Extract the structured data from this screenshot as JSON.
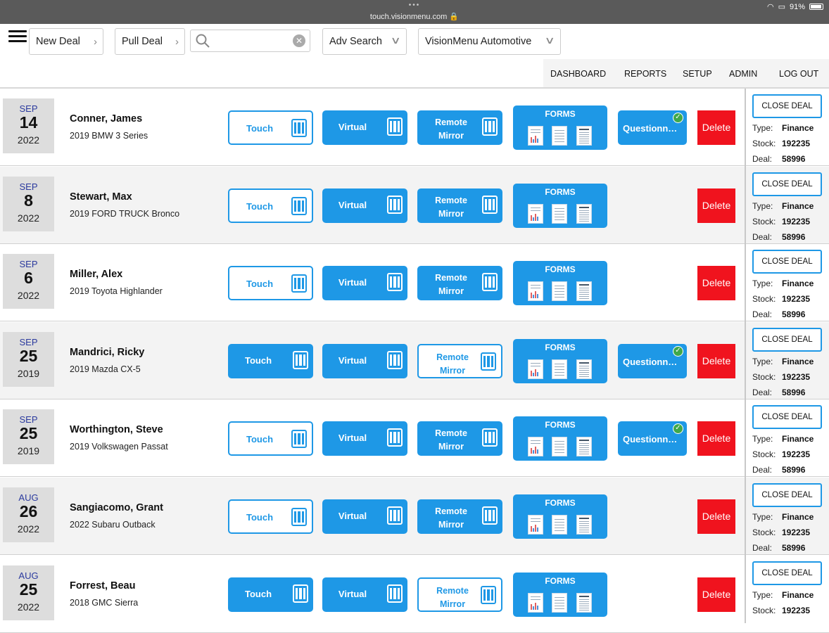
{
  "status_bar": {
    "dots": "•••",
    "url": "touch.visionmenu.com 🔒",
    "system": "91%"
  },
  "toolbar": {
    "new_deal": "New Deal",
    "pull_deal": "Pull Deal",
    "search_placeholder": "",
    "adv_search": "Adv Search",
    "dealer": "VisionMenu Automotive"
  },
  "nav": [
    "DASHBOARD",
    "REPORTS",
    "SETUP",
    "ADMIN",
    "LOG OUT"
  ],
  "labels": {
    "touch": "Touch",
    "virtual": "Virtual",
    "remote_1": "Remote",
    "remote_2": "Mirror",
    "forms": "FORMS",
    "questionnaire": "Questionnai...",
    "delete": "Delete",
    "close_deal": "CLOSE DEAL",
    "type_key": "Type:",
    "stock_key": "Stock:",
    "deal_key": "Deal:"
  },
  "colors": {
    "accent": "#1e98e6",
    "delete": "#f0131e",
    "check": "#3fa84a"
  },
  "deals": [
    {
      "month": "SEP",
      "day": "14",
      "year": "2022",
      "customer": "Conner, James",
      "vehicle": "2019 BMW 3 Series",
      "touch_outlined": true,
      "remote_outlined": false,
      "questionnaire": true,
      "type": "Finance",
      "stock": "192235",
      "deal": "58996"
    },
    {
      "month": "SEP",
      "day": "8",
      "year": "2022",
      "customer": "Stewart, Max",
      "vehicle": "2019 FORD TRUCK Bronco",
      "touch_outlined": true,
      "remote_outlined": false,
      "questionnaire": false,
      "type": "Finance",
      "stock": "192235",
      "deal": "58996"
    },
    {
      "month": "SEP",
      "day": "6",
      "year": "2022",
      "customer": "Miller, Alex",
      "vehicle": "2019 Toyota Highlander",
      "touch_outlined": true,
      "remote_outlined": false,
      "questionnaire": false,
      "type": "Finance",
      "stock": "192235",
      "deal": "58996"
    },
    {
      "month": "SEP",
      "day": "25",
      "year": "2019",
      "customer": "Mandrici, Ricky",
      "vehicle": "2019 Mazda CX-5",
      "touch_outlined": false,
      "remote_outlined": true,
      "questionnaire": true,
      "type": "Finance",
      "stock": "192235",
      "deal": "58996"
    },
    {
      "month": "SEP",
      "day": "25",
      "year": "2019",
      "customer": "Worthington, Steve",
      "vehicle": "2019 Volkswagen Passat",
      "touch_outlined": true,
      "remote_outlined": false,
      "questionnaire": true,
      "type": "Finance",
      "stock": "192235",
      "deal": "58996"
    },
    {
      "month": "AUG",
      "day": "26",
      "year": "2022",
      "customer": "Sangiacomo, Grant",
      "vehicle": "2022 Subaru Outback",
      "touch_outlined": true,
      "remote_outlined": false,
      "questionnaire": false,
      "type": "Finance",
      "stock": "192235",
      "deal": "58996"
    },
    {
      "month": "AUG",
      "day": "25",
      "year": "2022",
      "customer": "Forrest, Beau",
      "vehicle": "2018 GMC Sierra",
      "touch_outlined": false,
      "remote_outlined": true,
      "questionnaire": false,
      "type": "Finance",
      "stock": "192235"
    }
  ]
}
